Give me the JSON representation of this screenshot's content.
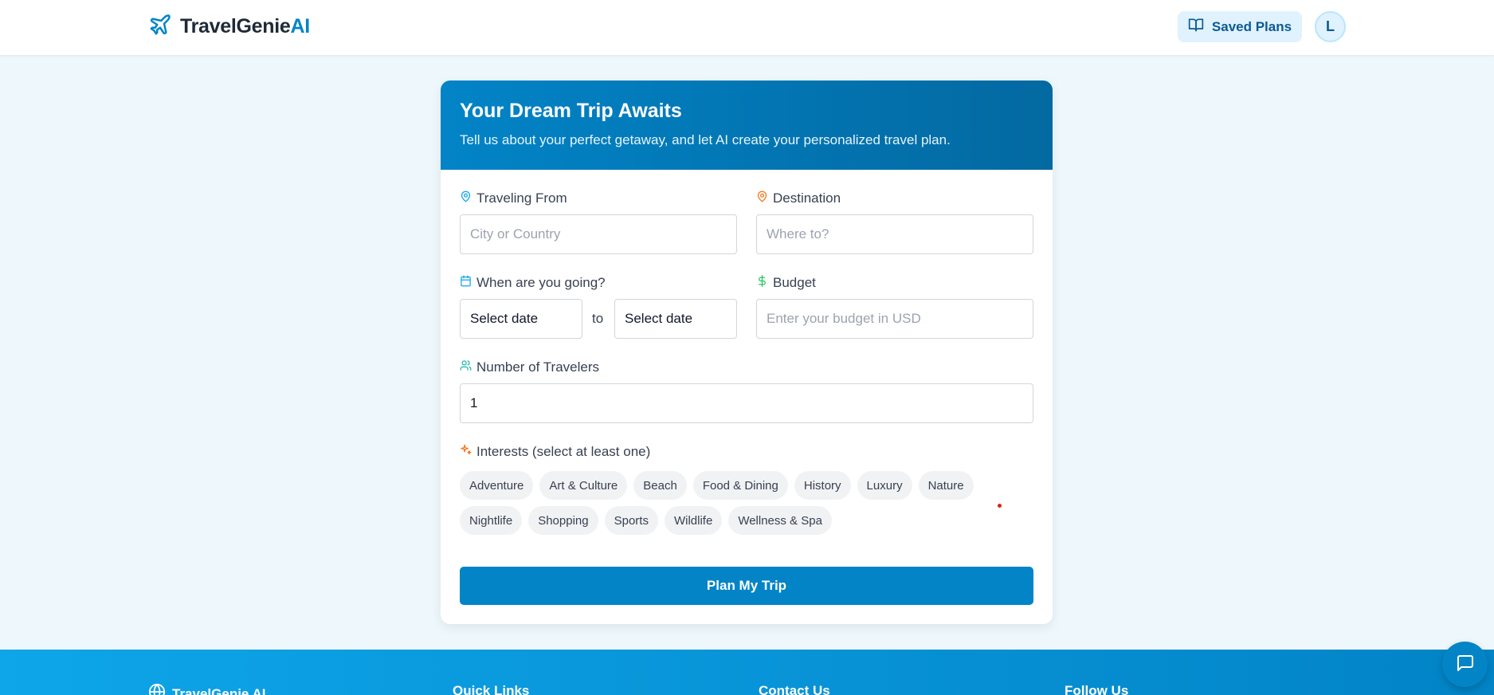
{
  "header": {
    "logo_main": "TravelGenie",
    "logo_accent": "AI",
    "saved_plans_label": "Saved Plans",
    "avatar_initial": "L"
  },
  "form": {
    "title": "Your Dream Trip Awaits",
    "subtitle": "Tell us about your perfect getaway, and let AI create your personalized travel plan.",
    "from_label": "Traveling From",
    "from_placeholder": "City or Country",
    "destination_label": "Destination",
    "destination_placeholder": "Where to?",
    "dates_label": "When are you going?",
    "start_date_value": "Select date",
    "to_text": "to",
    "end_date_value": "Select date",
    "budget_label": "Budget",
    "budget_placeholder": "Enter your budget in USD",
    "travelers_label": "Number of Travelers",
    "travelers_value": "1",
    "interests_label": "Interests (select at least one)",
    "interests_row1": [
      "Adventure",
      "Art & Culture",
      "Beach",
      "Food & Dining",
      "History",
      "Luxury",
      "Nature"
    ],
    "interests_row2": [
      "Nightlife",
      "Shopping",
      "Sports",
      "Wildlife",
      "Wellness & Spa"
    ],
    "submit_label": "Plan My Trip"
  },
  "footer": {
    "brand": "TravelGenie AI",
    "quick_links": "Quick Links",
    "contact": "Contact Us",
    "follow": "Follow Us"
  },
  "colors": {
    "accent": "#0284c7",
    "chip_bg": "#f1f2f4",
    "page_bg": "#eef8fc"
  },
  "icons": {
    "logo": "plane-icon",
    "saved": "book-open-icon",
    "from": "map-pin-icon",
    "destination": "map-pin-icon",
    "dates": "calendar-icon",
    "budget": "dollar-icon",
    "travelers": "users-icon",
    "interests": "sparkles-icon",
    "footer_brand": "globe-icon",
    "chat": "chat-bubble-icon"
  }
}
